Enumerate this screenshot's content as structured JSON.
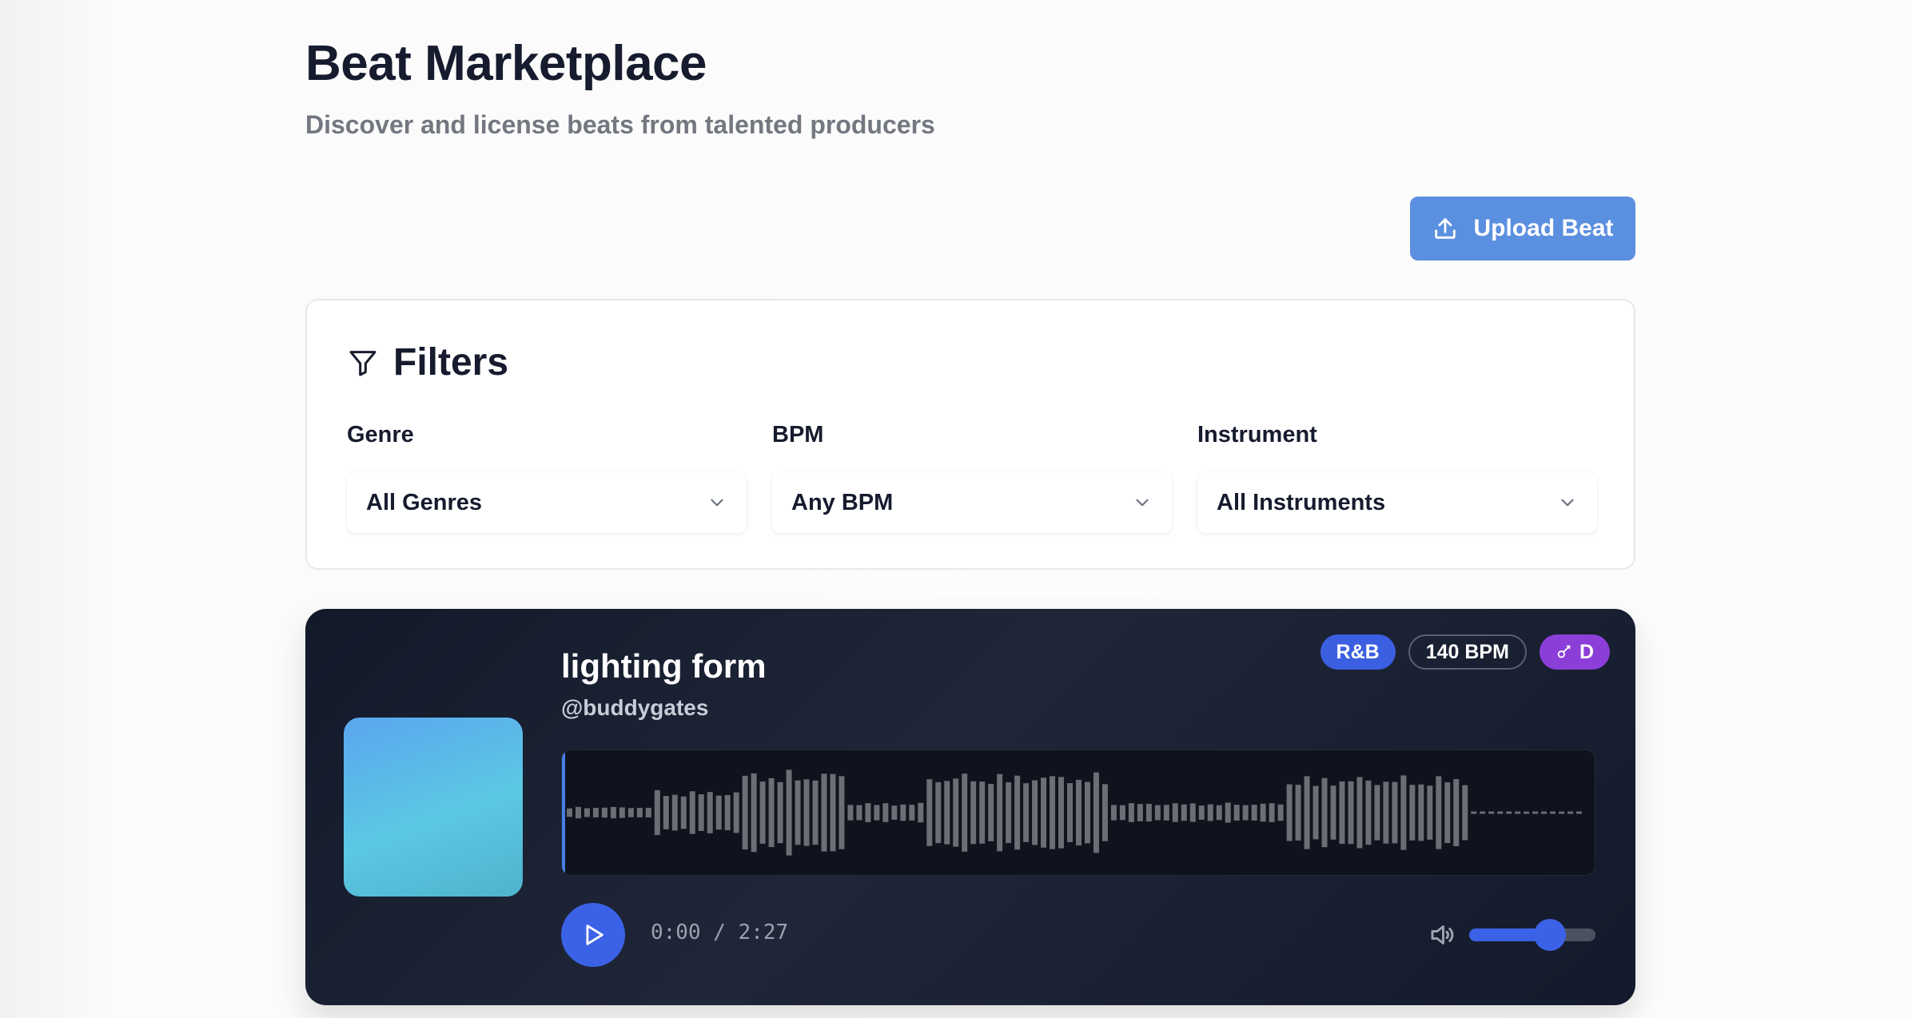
{
  "header": {
    "title": "Beat Marketplace",
    "subtitle": "Discover and license beats from talented producers"
  },
  "upload": {
    "label": "Upload Beat"
  },
  "filters": {
    "title": "Filters",
    "genre": {
      "label": "Genre",
      "value": "All Genres"
    },
    "bpm": {
      "label": "BPM",
      "value": "Any BPM"
    },
    "instrument": {
      "label": "Instrument",
      "value": "All Instruments"
    }
  },
  "beat": {
    "title": "lighting form",
    "producer": "@buddygates",
    "genre": "R&B",
    "bpm": "140 BPM",
    "key": "D",
    "time": "0:00 / 2:27",
    "progress": 0,
    "volume": 0.64
  },
  "colors": {
    "accent": "#3b62e6",
    "upload_button": "#5b8fe0",
    "genre_badge": "#3b5fe0",
    "key_badge": "#8b3fd8"
  },
  "icons": {
    "upload": "upload-icon",
    "filter": "filter-icon",
    "chevron": "chevron-down-icon",
    "key": "key-icon",
    "play": "play-icon",
    "volume": "volume-icon"
  }
}
